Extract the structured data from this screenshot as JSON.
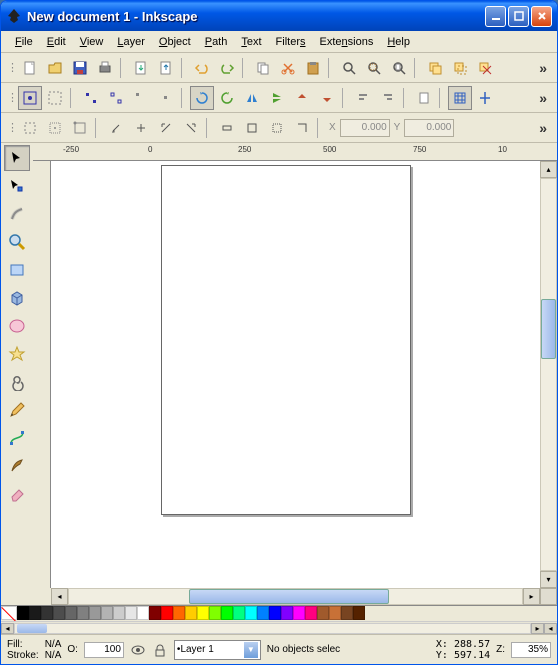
{
  "window": {
    "title": "New document 1 - Inkscape"
  },
  "menu": [
    "File",
    "Edit",
    "View",
    "Layer",
    "Object",
    "Path",
    "Text",
    "Filters",
    "Extensions",
    "Help"
  ],
  "toolbar1": [
    "new",
    "open",
    "save",
    "print",
    "|",
    "import",
    "export",
    "|",
    "undo",
    "redo",
    "|",
    "copy",
    "cut",
    "paste",
    "|",
    "zoom-page",
    "zoom-drawing",
    "zoom-selection",
    "|",
    "duplicate",
    "clone",
    "unlink",
    "overflow"
  ],
  "controls": {
    "x_label": "X",
    "x_value": "0.000",
    "y_label": "Y",
    "y_value": "0.000"
  },
  "ruler_marks": [
    "-250",
    "0",
    "250",
    "500",
    "750",
    "10"
  ],
  "tools": [
    "selector",
    "node",
    "tweak",
    "zoom",
    "rectangle",
    "3dbox",
    "ellipse",
    "star",
    "spiral",
    "pencil",
    "bezier",
    "calligraphy",
    "eraser"
  ],
  "palette": [
    "none",
    "#000000",
    "#1a1a1a",
    "#333333",
    "#4d4d4d",
    "#666666",
    "#808080",
    "#999999",
    "#b3b3b3",
    "#cccccc",
    "#e6e6e6",
    "#ffffff",
    "#800000",
    "#ff0000",
    "#ff6600",
    "#ffcc00",
    "#ffff00",
    "#80ff00",
    "#00ff00",
    "#00ff80",
    "#00ffff",
    "#0080ff",
    "#0000ff",
    "#8000ff",
    "#ff00ff",
    "#ff0080",
    "#a05a2c",
    "#c87137",
    "#784421",
    "#552200"
  ],
  "status": {
    "fill_label": "Fill:",
    "fill_value": "N/A",
    "stroke_label": "Stroke:",
    "stroke_value": "N/A",
    "opacity_label": "O:",
    "opacity_value": "100",
    "layer": "Layer 1",
    "message": "No objects selec",
    "x_label": "X:",
    "x_value": "288.57",
    "y_label": "Y:",
    "y_value": "597.14",
    "z_label": "Z:",
    "z_value": "35%"
  }
}
